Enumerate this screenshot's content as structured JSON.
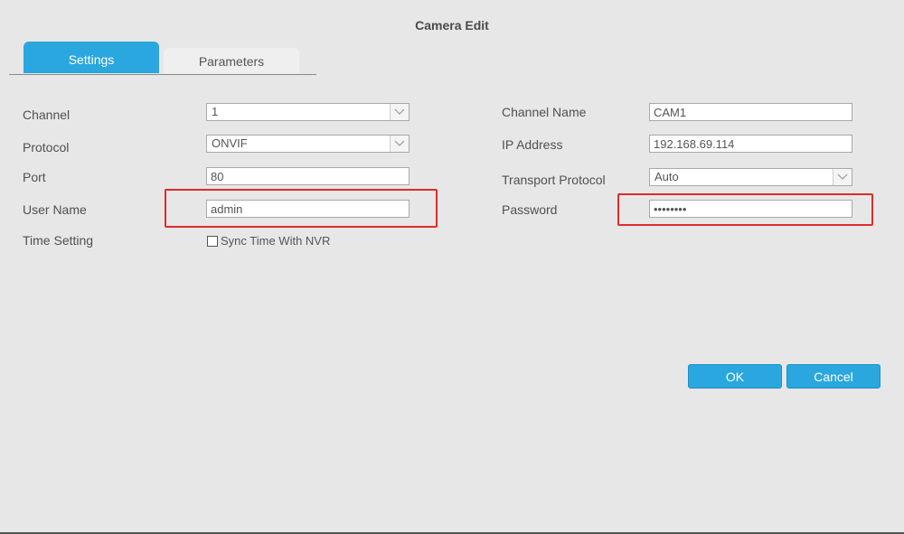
{
  "window": {
    "title": "Camera Edit"
  },
  "tabs": [
    {
      "label": "Settings",
      "active": true
    },
    {
      "label": "Parameters",
      "active": false
    }
  ],
  "left": {
    "channel": {
      "label": "Channel",
      "value": "1"
    },
    "protocol": {
      "label": "Protocol",
      "value": "ONVIF"
    },
    "port": {
      "label": "Port",
      "value": "80"
    },
    "username": {
      "label": "User Name",
      "value": "admin"
    },
    "time_setting": {
      "label": "Time Setting",
      "checkbox_label": "Sync Time With NVR",
      "checked": false
    }
  },
  "right": {
    "channel_name": {
      "label": "Channel Name",
      "value": "CAM1"
    },
    "ip_address": {
      "label": "IP Address",
      "value": "192.168.69.114"
    },
    "transport": {
      "label": "Transport Protocol",
      "value": "Auto"
    },
    "password": {
      "label": "Password",
      "value": "••••••••"
    }
  },
  "buttons": {
    "ok": "OK",
    "cancel": "Cancel"
  },
  "colors": {
    "accent": "#2aa7de",
    "highlight": "#e02b2b",
    "background": "#e7e7e7"
  }
}
